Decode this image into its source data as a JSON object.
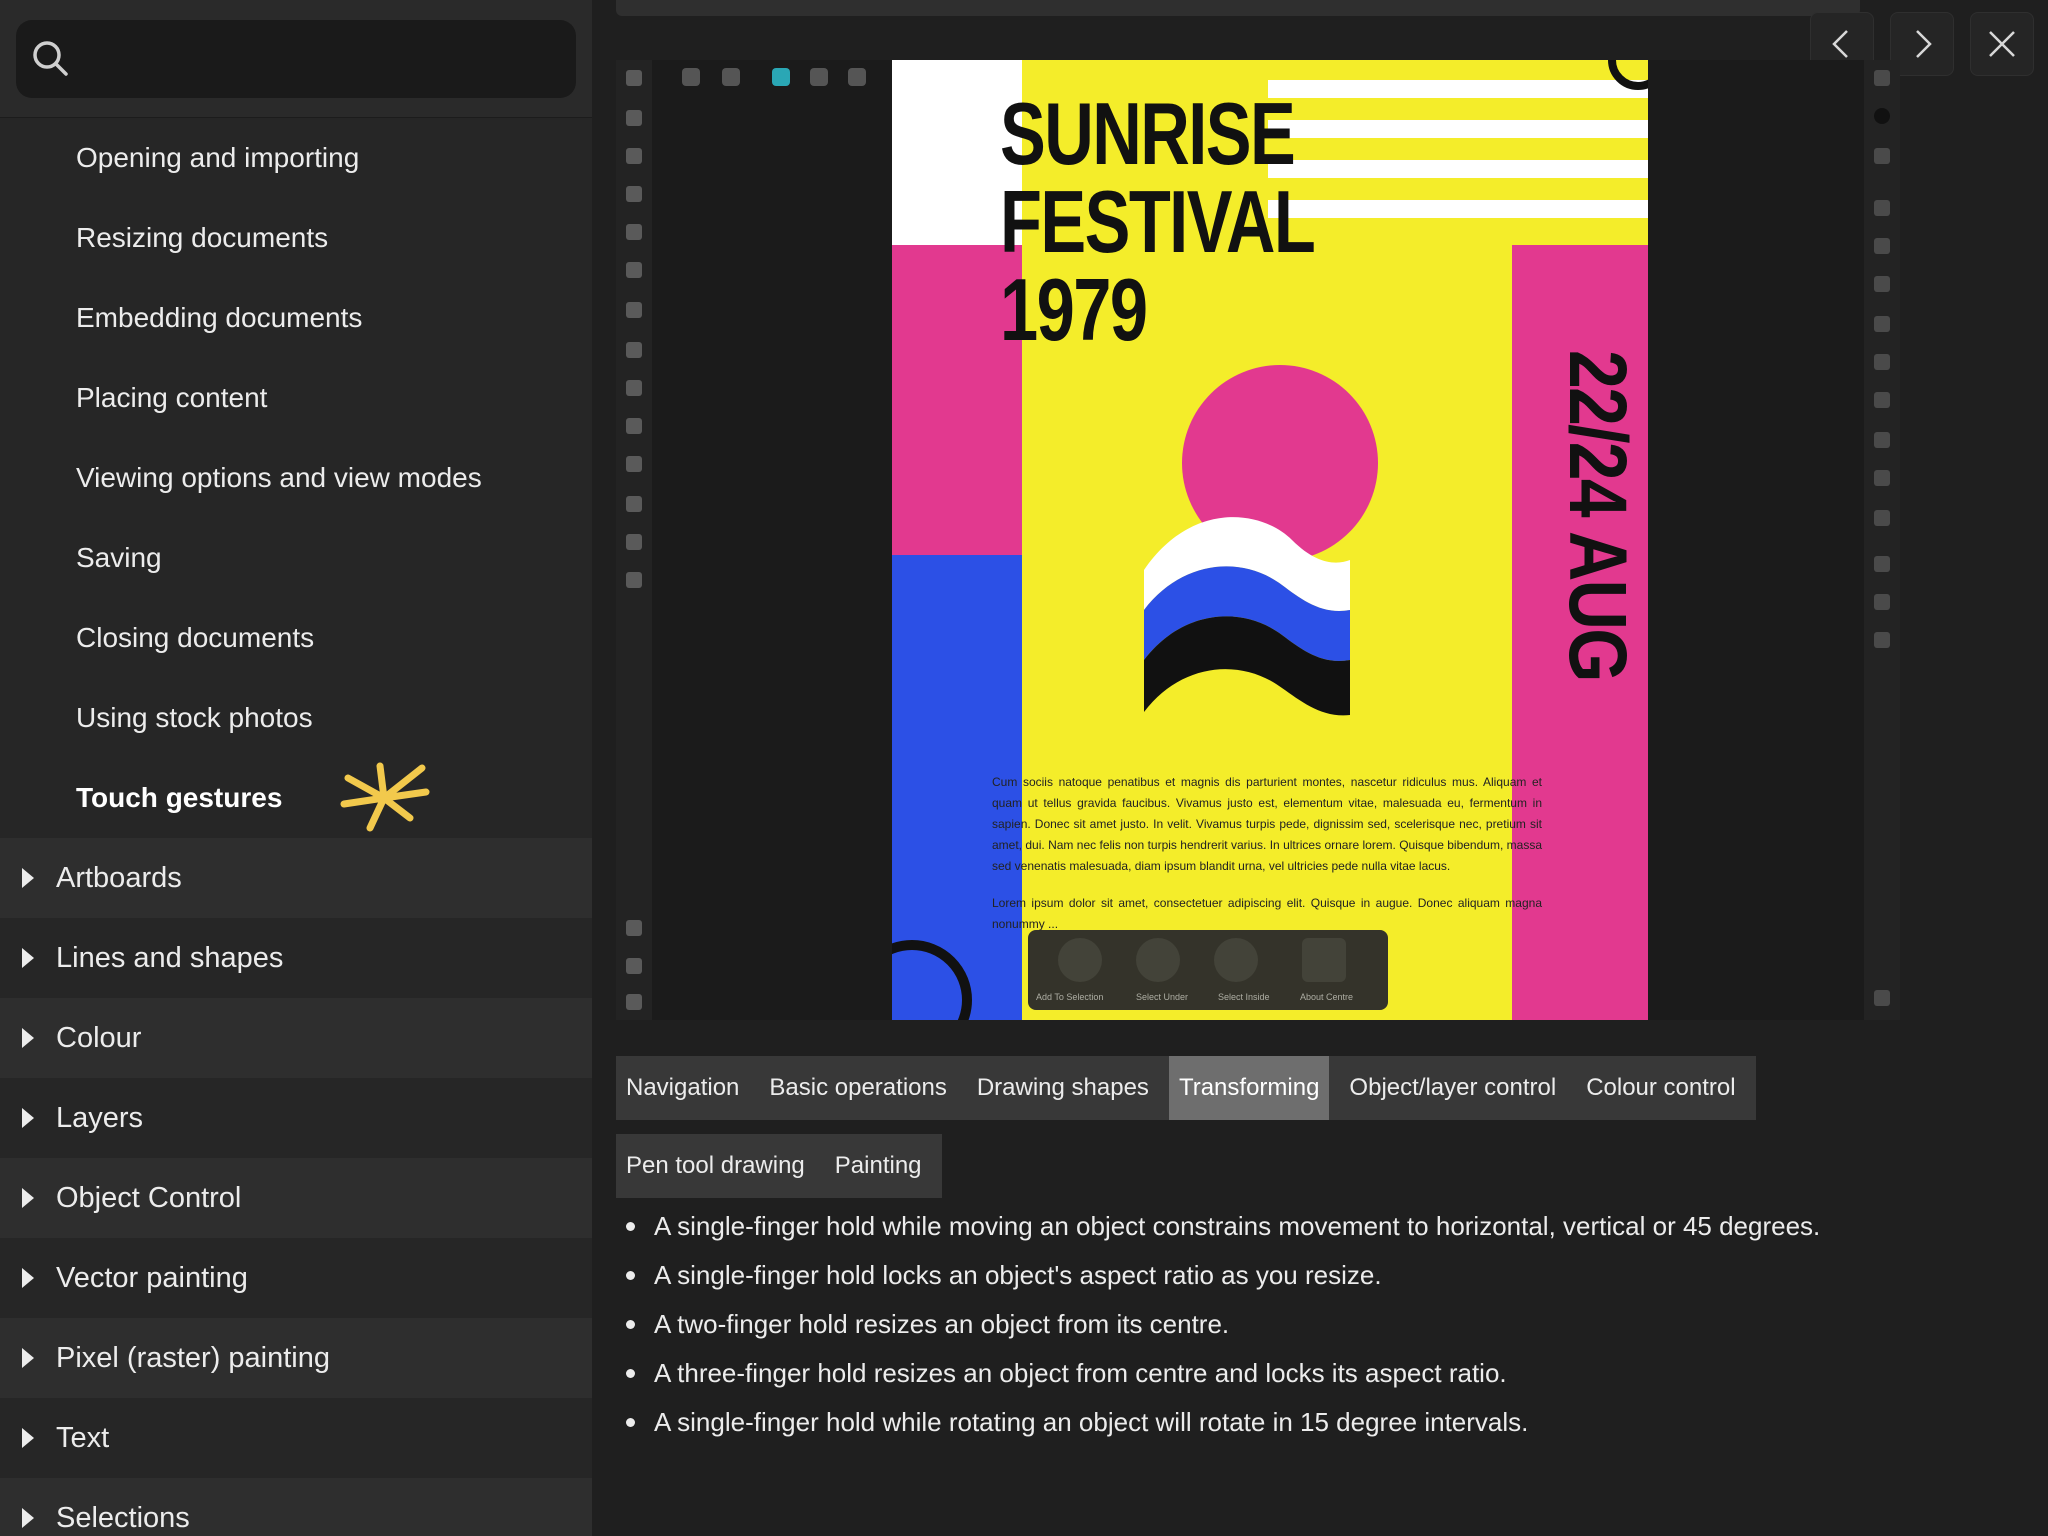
{
  "search": {
    "placeholder": "",
    "value": ""
  },
  "sidebar": {
    "sub_items": [
      {
        "label": "Opening and importing",
        "active": false
      },
      {
        "label": "Resizing documents",
        "active": false
      },
      {
        "label": "Embedding documents",
        "active": false
      },
      {
        "label": "Placing content",
        "active": false
      },
      {
        "label": "Viewing options and view modes",
        "active": false
      },
      {
        "label": "Saving",
        "active": false
      },
      {
        "label": "Closing documents",
        "active": false
      },
      {
        "label": "Using stock photos",
        "active": false
      },
      {
        "label": "Touch gestures",
        "active": true
      }
    ],
    "sections": [
      {
        "label": "Artboards"
      },
      {
        "label": "Lines and shapes"
      },
      {
        "label": "Colour"
      },
      {
        "label": "Layers"
      },
      {
        "label": "Object Control"
      },
      {
        "label": "Vector painting"
      },
      {
        "label": "Pixel (raster) painting"
      },
      {
        "label": "Text"
      },
      {
        "label": "Selections"
      }
    ]
  },
  "poster": {
    "title": "SUNRISE\nFESTIVAL\n1979",
    "date": "22/24 AUG",
    "body_1": "Cum sociis natoque penatibus et magnis dis parturient montes, nascetur ridiculus mus. Aliquam et quam ut tellus gravida faucibus. Vivamus justo est, elementum vitae, malesuada eu, fermentum in sapien. Donec sit amet justo. In velit. Vivamus turpis pede, dignissim sed, scelerisque nec, pretium sit amet, dui. Nam nec felis non turpis hendrerit varius. In ultrices ornare lorem. Quisque bibendum, massa sed venenatis malesuada, diam ipsum blandit urna, vel ultricies pede nulla vitae lacus.",
    "body_2": "Lorem ipsum dolor sit amet, consectetuer adipiscing elit. Quisque in augue. Donec aliquam magna nonummy ..."
  },
  "selection_bar": {
    "labels": [
      "Add To Selection",
      "Select Under",
      "Select Inside",
      "About Centre"
    ]
  },
  "tabs": {
    "row1": [
      {
        "label": "Navigation",
        "active": false
      },
      {
        "label": "Basic operations",
        "active": false
      },
      {
        "label": "Drawing shapes",
        "active": false
      },
      {
        "label": "Transforming",
        "active": true
      },
      {
        "label": "Object/layer control",
        "active": false
      },
      {
        "label": "Colour control",
        "active": false
      }
    ],
    "row2": [
      {
        "label": "Pen tool drawing",
        "active": false
      },
      {
        "label": "Painting",
        "active": false
      }
    ]
  },
  "content": {
    "bullets": [
      "A single-finger hold while moving an object constrains movement to horizontal, vertical or 45 degrees.",
      "A single-finger hold locks an object's aspect ratio as you resize.",
      "A two-finger hold resizes an object from its centre.",
      "A three-finger hold resizes an object from centre and locks its aspect ratio.",
      "A single-finger hold while rotating an object will rotate in 15 degree intervals."
    ]
  },
  "icons": {
    "search": "search-icon",
    "star": "asterisk-star-icon",
    "prev": "chevron-left-icon",
    "next": "chevron-right-icon",
    "close": "close-icon",
    "expand": "triangle-right-icon"
  },
  "colors": {
    "sidebar_bg": "#262626",
    "main_bg": "#1f1f1f",
    "active_tab": "#6e6e6e",
    "star": "#f2c94c",
    "poster_yellow": "#f4ed2a",
    "poster_pink": "#e2398f",
    "poster_blue": "#2c50e6"
  }
}
